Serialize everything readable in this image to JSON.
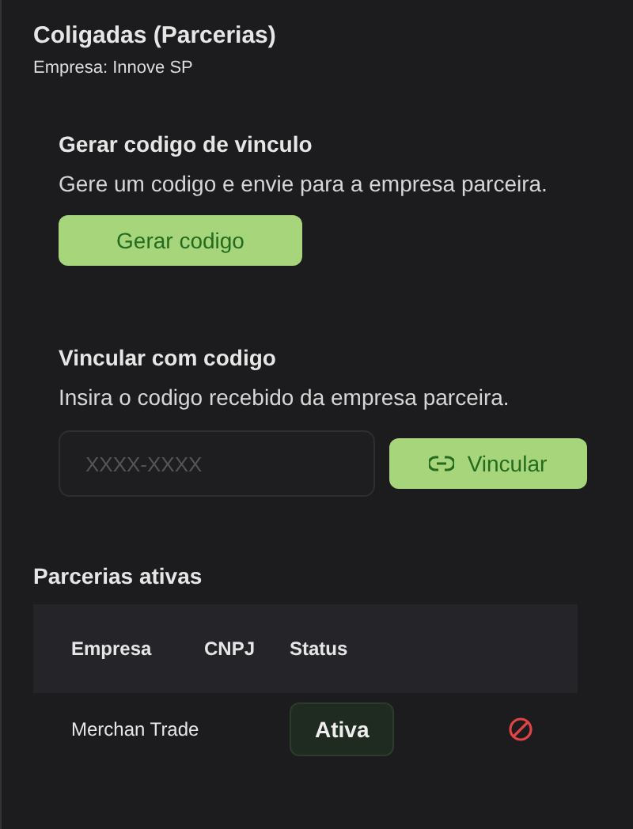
{
  "title": "Coligadas (Parcerias)",
  "subtitle": "Empresa: Innove SP",
  "generate": {
    "heading": "Gerar codigo de vinculo",
    "description": "Gere um codigo e envie para a empresa parceira.",
    "button": "Gerar codigo"
  },
  "link": {
    "heading": "Vincular com codigo",
    "description": "Insira o codigo recebido da empresa parceira.",
    "placeholder": "XXXX-XXXX",
    "button": "Vincular"
  },
  "partnerships": {
    "heading": "Parcerias ativas",
    "columns": [
      "Empresa",
      "CNPJ",
      "Status"
    ],
    "rows": [
      {
        "empresa": "Merchan Trade",
        "status": "Ativa"
      }
    ]
  }
}
